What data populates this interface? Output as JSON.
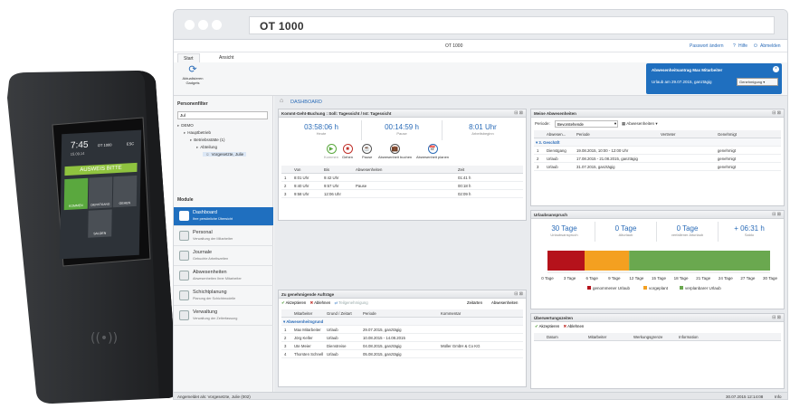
{
  "device": {
    "time": "7:45",
    "date": "15.09.14",
    "clock_title": "OT 1000",
    "esc": "ESC",
    "banner": "AUSWEIS BITTE",
    "buttons": [
      "KOMMEN",
      "DIENSTGANG",
      "GEHEN",
      "SALDEN"
    ],
    "rfid": "((•))"
  },
  "browser": {
    "url_title": "OT 1000"
  },
  "app": {
    "title": "OT 1000",
    "top_links": [
      "Passwort ändern",
      "Hilfe",
      "Abmelden"
    ],
    "tabs": [
      "Start",
      "Ansicht"
    ],
    "ribbon_button": [
      "Aktualisieren",
      "Gadgets"
    ]
  },
  "notification": {
    "title": "Abwesenheitsantrag Max Mitarbeiter",
    "text": "Urlaub am 29.07.2015, ganztägig",
    "button": "Genehmigung"
  },
  "sidebar": {
    "personfilter_title": "Personenfilter",
    "filter_value": "Jul",
    "tree": [
      {
        "label": "DEMO",
        "indent": 0
      },
      {
        "label": "Hauptbetrieb",
        "indent": 1
      },
      {
        "label": "Betriebsstätte (1)",
        "indent": 2
      },
      {
        "label": "Abteilung",
        "indent": 3
      },
      {
        "label": "Vorgesetzte, Julie",
        "indent": 4
      }
    ],
    "module_title": "Module",
    "modules": [
      {
        "title": "Dashboard",
        "sub": "Ihre persönliche Übersicht",
        "active": true
      },
      {
        "title": "Personal",
        "sub": "Verwaltung der Mitarbeiter",
        "active": false
      },
      {
        "title": "Journale",
        "sub": "Gebuchte Arbeitszeiten",
        "active": false
      },
      {
        "title": "Abwesenheiten",
        "sub": "Abwesenheiten Ihrer Mitarbeiter",
        "active": false
      },
      {
        "title": "Schichtplanung",
        "sub": "Planung der Schichtmodelle",
        "active": false
      },
      {
        "title": "Verwaltung",
        "sub": "Verwaltung der Zeiterfassung",
        "active": false
      }
    ]
  },
  "dashboard_title": "DASHBOARD",
  "booking": {
    "title": "Kommt-Geht-Buchung : Soll: Tagessicht / Ist: Tagessicht",
    "kpis": [
      {
        "value": "03:58:06 h",
        "label": "Heute"
      },
      {
        "value": "00:14:59 h",
        "label": "Pause"
      },
      {
        "value": "8:01 Uhr",
        "label": "Arbeitsbeginn"
      }
    ],
    "actions": [
      "Kommen",
      "Gehen",
      "Pause",
      "Abwesenheit buchen",
      "Abwesenheit planen"
    ],
    "headers": [
      "Von",
      "Bis",
      "Abwesenheiten",
      "Zeit"
    ],
    "rows": [
      [
        "1",
        "8:01 Uhr",
        "9:42 Uhr",
        "",
        "01:41 h"
      ],
      [
        "2",
        "9:40 Uhr",
        "9:57 Uhr",
        "Pause",
        "00:18 h"
      ],
      [
        "3",
        "9:58 Uhr",
        "12:06 Uhr",
        "",
        "02:09 h"
      ]
    ]
  },
  "orders": {
    "title": "Zu genehmigende Aufträge",
    "toolbar": [
      "Akzeptieren",
      "Ablehnen",
      "Teilgenehmigung"
    ],
    "toolbar_right": [
      "Zeitarten",
      "Abwesenheiten"
    ],
    "headers": [
      "Mitarbeiter",
      "Grund / Zeitart",
      "Periode",
      "Kommentar"
    ],
    "group": "Abwesenheitsgrund",
    "rows": [
      [
        "1",
        "Max Mitarbeiter",
        "Urlaub",
        "29.07.2015, ganztägig",
        ""
      ],
      [
        "2",
        "Jörg Keller",
        "Urlaub",
        "10.08.2015 - 14.08.2015",
        ""
      ],
      [
        "3",
        "Ute Meier",
        "Dienstreise",
        "04.08.2015, ganztägig",
        "Müller GmbH & Co KG"
      ],
      [
        "4",
        "Thorsten Schnell",
        "Urlaub",
        "05.08.2015, ganztägig",
        ""
      ]
    ]
  },
  "my_absences": {
    "title": "Meine Abwesenheiten",
    "period_label": "Periode:",
    "period_value": "Bevorstehende",
    "dropdown": "Abwesenheiten",
    "headers": [
      "Abwesen...",
      "Periode",
      "Vertreter",
      "Genehmigt"
    ],
    "group": "3. Geschäft",
    "rows": [
      [
        "1",
        "Dienstgang",
        "19.08.2015, 10:00 - 12:00 Uhr",
        "",
        "genehmigt"
      ],
      [
        "2",
        "Urlaub",
        "17.08.2015 - 21.08.2015, ganztägig",
        "",
        "genehmigt"
      ],
      [
        "3",
        "Urlaub",
        "31.07.2015, ganztägig",
        "",
        "genehmigt"
      ]
    ]
  },
  "vacation": {
    "title": "Urlaubsanspruch",
    "kpis": [
      {
        "value": "30 Tage",
        "label": "Urlaubsanspruch"
      },
      {
        "value": "0 Tage",
        "label": "Alturlaub"
      },
      {
        "value": "0 Tage",
        "label": "verfallener Alturlaub"
      },
      {
        "value": "+ 06:31 h",
        "label": "Saldo"
      }
    ]
  },
  "chart_data": {
    "type": "bar",
    "orientation": "horizontal-stacked",
    "series": [
      {
        "name": "genommener Urlaub",
        "values": [
          5
        ]
      },
      {
        "name": "vorgeplant",
        "values": [
          6
        ]
      },
      {
        "name": "verplanbarer Urlaub",
        "values": [
          19
        ]
      }
    ],
    "colors": [
      "#b5121b",
      "#f4a020",
      "#6aa84f"
    ],
    "xlim": [
      0,
      30
    ],
    "tick_labels": [
      "0 Tage",
      "3 Tage",
      "6 Tage",
      "9 Tage",
      "12 Tage",
      "15 Tage",
      "18 Tage",
      "21 Tage",
      "24 Tage",
      "27 Tage",
      "30 Tage"
    ],
    "legend": "bottom"
  },
  "overtime": {
    "title": "Überwertungszeiten",
    "toolbar": [
      "Akzeptieren",
      "Ablehnen"
    ],
    "headers": [
      "Datum",
      "Mitarbeiter",
      "Werkungsgrenze",
      "Information"
    ]
  },
  "status": {
    "left": "Angemeldet als: Vorgesetzte, Julie (002)",
    "right": "30.07.2015 12:14:08",
    "info": "Info"
  },
  "colors": {
    "accent": "#1f6fbf",
    "kpi": "#2b6cb8"
  }
}
